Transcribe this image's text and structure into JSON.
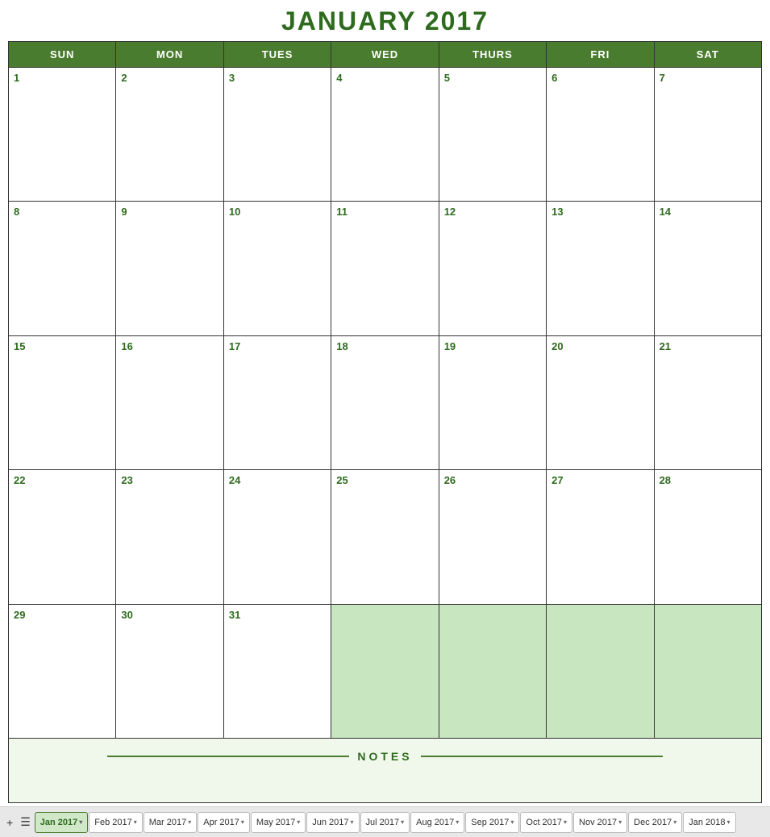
{
  "title": "JANUARY 2017",
  "colors": {
    "header_bg": "#4a7c2f",
    "text_green": "#2e6b1e",
    "empty_cell": "#c8e6c0",
    "notes_bg": "#f0f8eb"
  },
  "day_headers": [
    "SUN",
    "MON",
    "TUES",
    "WED",
    "THURS",
    "FRI",
    "SAT"
  ],
  "weeks": [
    [
      {
        "num": "1",
        "empty": false
      },
      {
        "num": "2",
        "empty": false
      },
      {
        "num": "3",
        "empty": false
      },
      {
        "num": "4",
        "empty": false
      },
      {
        "num": "5",
        "empty": false
      },
      {
        "num": "6",
        "empty": false
      },
      {
        "num": "7",
        "empty": false
      }
    ],
    [
      {
        "num": "8",
        "empty": false
      },
      {
        "num": "9",
        "empty": false
      },
      {
        "num": "10",
        "empty": false
      },
      {
        "num": "11",
        "empty": false
      },
      {
        "num": "12",
        "empty": false
      },
      {
        "num": "13",
        "empty": false
      },
      {
        "num": "14",
        "empty": false
      }
    ],
    [
      {
        "num": "15",
        "empty": false
      },
      {
        "num": "16",
        "empty": false
      },
      {
        "num": "17",
        "empty": false
      },
      {
        "num": "18",
        "empty": false
      },
      {
        "num": "19",
        "empty": false
      },
      {
        "num": "20",
        "empty": false
      },
      {
        "num": "21",
        "empty": false
      }
    ],
    [
      {
        "num": "22",
        "empty": false
      },
      {
        "num": "23",
        "empty": false
      },
      {
        "num": "24",
        "empty": false
      },
      {
        "num": "25",
        "empty": false
      },
      {
        "num": "26",
        "empty": false
      },
      {
        "num": "27",
        "empty": false
      },
      {
        "num": "28",
        "empty": false
      }
    ],
    [
      {
        "num": "29",
        "empty": false
      },
      {
        "num": "30",
        "empty": false
      },
      {
        "num": "31",
        "empty": false
      },
      {
        "num": "",
        "empty": true
      },
      {
        "num": "",
        "empty": true
      },
      {
        "num": "",
        "empty": true
      },
      {
        "num": "",
        "empty": true
      }
    ]
  ],
  "notes_label": "NOTES",
  "tabs": [
    {
      "label": "Jan 2017",
      "active": true
    },
    {
      "label": "Feb 2017",
      "active": false
    },
    {
      "label": "Mar 2017",
      "active": false
    },
    {
      "label": "Apr 2017",
      "active": false
    },
    {
      "label": "May 2017",
      "active": false
    },
    {
      "label": "Jun 2017",
      "active": false
    },
    {
      "label": "Jul 2017",
      "active": false
    },
    {
      "label": "Aug 2017",
      "active": false
    },
    {
      "label": "Sep 2017",
      "active": false
    },
    {
      "label": "Oct 2017",
      "active": false
    },
    {
      "label": "Nov 2017",
      "active": false
    },
    {
      "label": "Dec 2017",
      "active": false
    },
    {
      "label": "Jan 2018",
      "active": false
    }
  ],
  "add_button": "+",
  "menu_button": "☰"
}
